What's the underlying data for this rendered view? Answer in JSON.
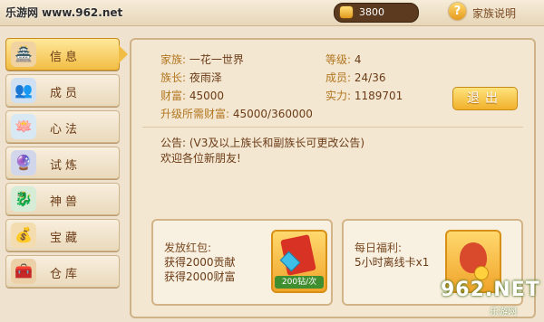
{
  "watermark_top": "乐游网 www.962.net",
  "topbar": {
    "gold": "3800",
    "help_label": "家族说明",
    "help_icon": "question-mark-icon"
  },
  "sidebar": {
    "items": [
      {
        "label": "信息",
        "icon": "castle-flag-icon",
        "active": true
      },
      {
        "label": "成员",
        "icon": "members-icon",
        "active": false
      },
      {
        "label": "心法",
        "icon": "lotus-icon",
        "active": false
      },
      {
        "label": "试炼",
        "icon": "trial-orb-icon",
        "active": false
      },
      {
        "label": "神兽",
        "icon": "beast-icon",
        "active": false
      },
      {
        "label": "宝藏",
        "icon": "treasure-icon",
        "active": false
      },
      {
        "label": "仓库",
        "icon": "chest-icon",
        "active": false
      }
    ]
  },
  "info": {
    "family_key": "家族:",
    "family_val": "一花一世界",
    "level_key": "等级:",
    "level_val": "4",
    "leader_key": "族长:",
    "leader_val": "夜雨泽",
    "members_key": "成员:",
    "members_val": "24/36",
    "wealth_key": "财富:",
    "wealth_val": "45000",
    "power_key": "实力:",
    "power_val": "1189701",
    "upgrade_key": "升级所需财富:",
    "upgrade_val": "45000/360000"
  },
  "exit_button": "退出",
  "notice": {
    "line1": "公告: (V3及以上族长和副族长可更改公告)",
    "line2": "欢迎各位新朋友!"
  },
  "cards": {
    "redpacket": {
      "title": "发放红包:",
      "line1": "获得2000贡献",
      "line2": "获得2000财富",
      "price": "200钻/次"
    },
    "daily": {
      "title": "每日福利:",
      "line1": "5小时离线卡x1"
    }
  },
  "watermark_br": "962.NET",
  "watermark_br_sub": "乐游网"
}
